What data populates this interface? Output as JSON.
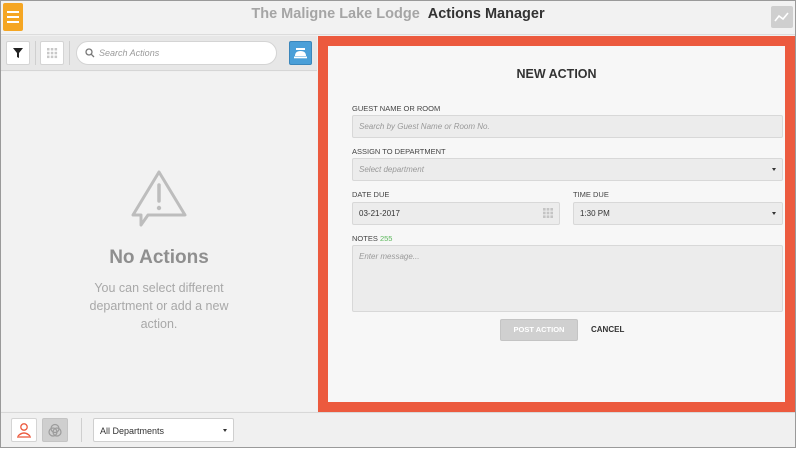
{
  "header": {
    "hotel_name": "The Maligne Lake Lodge",
    "app_title": "Actions Manager",
    "menu_icon": "hamburger-menu-icon",
    "right_icon": "trend-chart-icon",
    "accent_color": "#f5a623"
  },
  "toolbar": {
    "search_placeholder": "Search Actions",
    "filter_icon": "filter-funnel-icon",
    "grid_icon": "grid-view-icon",
    "bell_icon": "concierge-bell-icon"
  },
  "empty_state": {
    "icon": "warning-speech-bubble-icon",
    "title": "No Actions",
    "message": "You can select different department or add a new action."
  },
  "new_action": {
    "title": "NEW ACTION",
    "panel_color": "#ec5a3e",
    "guest": {
      "label": "GUEST NAME OR ROOM",
      "placeholder": "Search by Guest Name or Room No."
    },
    "department": {
      "label": "ASSIGN TO DEPARTMENT",
      "placeholder": "Select department"
    },
    "date_due": {
      "label": "DATE DUE",
      "value": "03-21-2017"
    },
    "time_due": {
      "label": "TIME DUE",
      "value": "1:30 PM"
    },
    "notes": {
      "label": "NOTES",
      "count": "255",
      "placeholder": "Enter message..."
    },
    "post_label": "POST ACTION",
    "cancel_label": "CANCEL"
  },
  "footer": {
    "department_selected": "All Departments",
    "user_icon": "user-icon",
    "team_icon": "team-circles-icon"
  }
}
